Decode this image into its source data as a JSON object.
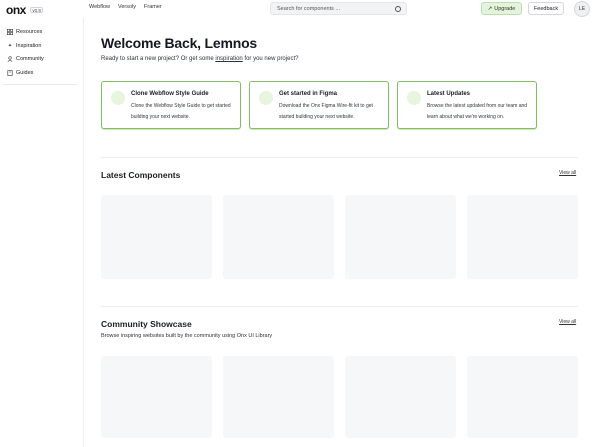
{
  "header": {
    "logo_text": "onx",
    "version": "v0.8",
    "nav": [
      "Webflow",
      "Versoly",
      "Framer"
    ],
    "search_placeholder": "Search for components ...",
    "upgrade_label": "Upgrade",
    "feedback_label": "Feedback",
    "avatar_initials": "LE"
  },
  "sidebar": {
    "items": [
      {
        "label": "Resources",
        "icon": "grid-icon"
      },
      {
        "label": "Inspiration",
        "icon": "sparkle-icon"
      },
      {
        "label": "Community",
        "icon": "user-icon"
      },
      {
        "label": "Guides",
        "icon": "book-icon"
      }
    ]
  },
  "main": {
    "title": "Welcome Back, Lemnos",
    "subtitle_before": "Ready to start a new project? Or get some ",
    "subtitle_link": "inspiration",
    "subtitle_after": " for you new project?",
    "cards": [
      {
        "title": "Clone Webflow Style Guide",
        "desc": "Clone the Webflow Style Guide to get started building your next website."
      },
      {
        "title": "Get started in Figma",
        "desc": "Download the Onx Figma Wire-fit kit to get started building your next website."
      },
      {
        "title": "Latest Updates",
        "desc": "Browse the latest updated from our team and learn about what we're working on."
      }
    ],
    "latest": {
      "title": "Latest Components",
      "view_all": "View all"
    },
    "community": {
      "title": "Community Showcase",
      "subtitle": "Browse inspiring websites built by the community using Onx UI Library",
      "view_all": "View all"
    }
  },
  "colors": {
    "accent_green": "#7fbf5f",
    "upgrade_bg": "#e3f3dc",
    "tile_bg": "#f6f7f8"
  }
}
